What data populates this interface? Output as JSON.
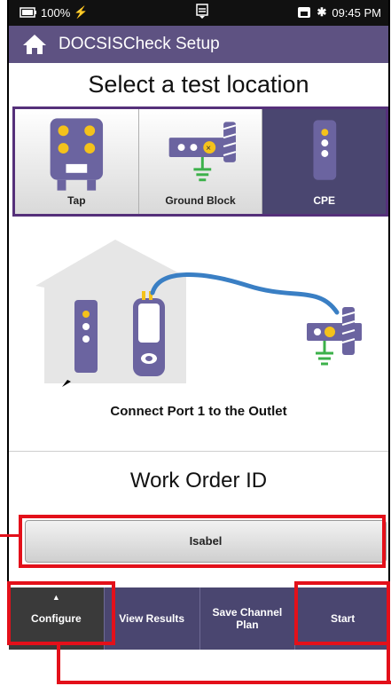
{
  "status_bar": {
    "battery": "100%",
    "time": "09:45 PM",
    "icons": [
      "battery-icon",
      "charging-bolt-icon",
      "download-icon",
      "device-icon",
      "bluetooth-icon"
    ]
  },
  "header": {
    "title": "DOCSISCheck Setup",
    "home_icon": "home-icon"
  },
  "location": {
    "prompt": "Select a test location",
    "options": [
      {
        "label": "Tap",
        "selected": false
      },
      {
        "label": "Ground Block",
        "selected": false
      },
      {
        "label": "CPE",
        "selected": true
      }
    ]
  },
  "instruction": "Connect Port 1 to the Outlet",
  "work_order": {
    "title": "Work Order ID",
    "value": "Isabel"
  },
  "bottom_bar": {
    "configure": "Configure",
    "view_results": "View Results",
    "save_channel_plan": "Save Channel Plan",
    "start": "Start"
  },
  "colors": {
    "header": "#5e5282",
    "selected_tile": "#4a4670",
    "highlight": "#e3101a",
    "device_purple": "#6b64a0",
    "cable_blue": "#3a7fc4",
    "ground_green": "#3cb14a",
    "tap_yellow": "#f4c21b"
  }
}
